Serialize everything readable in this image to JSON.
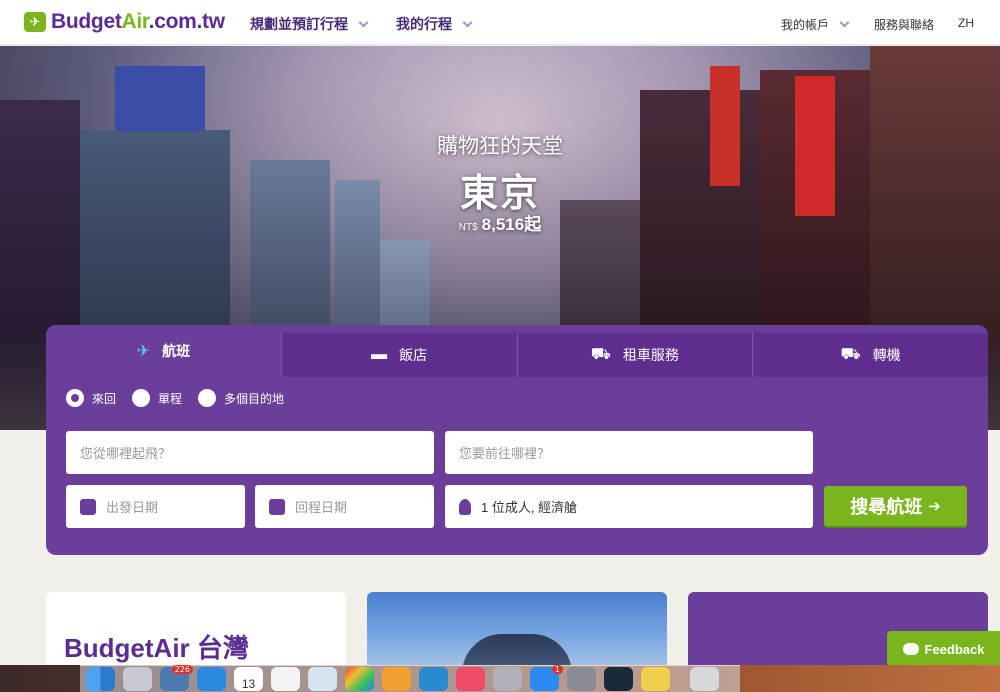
{
  "header": {
    "logo_main": "Budget",
    "logo_accent": "Air",
    "logo_suffix": ".com.tw",
    "nav": [
      {
        "label": "規劃並預訂行程"
      },
      {
        "label": "我的行程"
      }
    ],
    "account": "我的帳戶",
    "service": "服務與聯絡",
    "language": "ZH"
  },
  "hero": {
    "subtitle": "購物狂的天堂",
    "city": "東京",
    "currency": "NT$",
    "price": "8,516起"
  },
  "search": {
    "tabs": [
      {
        "label": "航班",
        "icon": "plane-icon"
      },
      {
        "label": "飯店",
        "icon": "bed-icon"
      },
      {
        "label": "租車服務",
        "icon": "car-icon"
      },
      {
        "label": "轉機",
        "icon": "taxi-icon"
      }
    ],
    "trip_types": [
      "來回",
      "單程",
      "多個目的地"
    ],
    "selected_trip_type": "來回",
    "from_placeholder": "您從哪裡起飛？",
    "to_placeholder": "您要前往哪裡？",
    "depart_placeholder": "出發日期",
    "return_placeholder": "回程日期",
    "passengers": "1 位成人, 經濟艙",
    "search_button": "搜尋航班"
  },
  "cards": {
    "card1_title": "BudgetAir 台灣"
  },
  "feedback": "Feedback",
  "dock": {
    "mail_badge": "226",
    "calendar_day": "13",
    "appstore_badge": "1"
  },
  "colors": {
    "brand_purple": "#6b3f99",
    "brand_green": "#7ab51d"
  }
}
